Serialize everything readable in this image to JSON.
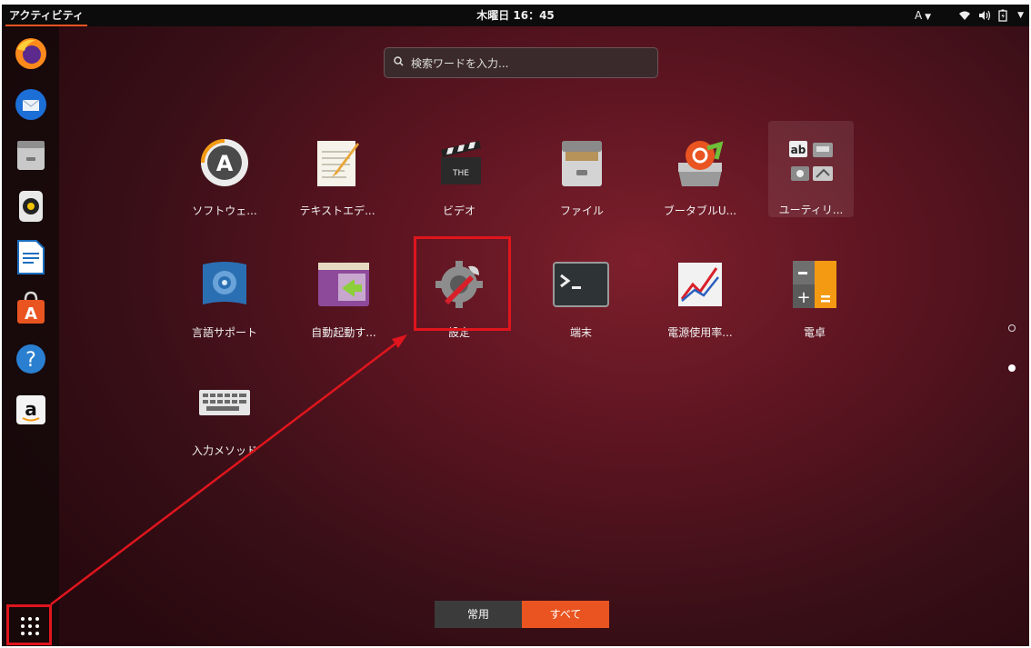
{
  "topbar": {
    "activities": "アクティビティ",
    "clock": "木曜日 16：45",
    "input_method": "A"
  },
  "search": {
    "placeholder": "検索ワードを入力..."
  },
  "apps": [
    {
      "label": "ソフトウェ...",
      "icon": "software-icon"
    },
    {
      "label": "テキストエデ...",
      "icon": "text-editor-icon"
    },
    {
      "label": "ビデオ",
      "icon": "video-icon"
    },
    {
      "label": "ファイル",
      "icon": "files-icon"
    },
    {
      "label": "ブータブルU...",
      "icon": "usb-creator-icon"
    },
    {
      "label": "ユーティリ...",
      "icon": "utilities-folder-icon"
    },
    {
      "label": "言語サポート",
      "icon": "language-support-icon"
    },
    {
      "label": "自動起動す...",
      "icon": "startup-apps-icon"
    },
    {
      "label": "設定",
      "icon": "settings-icon"
    },
    {
      "label": "端末",
      "icon": "terminal-icon"
    },
    {
      "label": "電源使用率...",
      "icon": "power-stats-icon"
    },
    {
      "label": "電卓",
      "icon": "calculator-icon"
    },
    {
      "label": "入力メソッド",
      "icon": "input-method-icon"
    }
  ],
  "view_tabs": {
    "frequent": "常用",
    "all": "すべて"
  },
  "colors": {
    "accent": "#e95420",
    "highlight": "#e0151d"
  },
  "pages": {
    "total": 2,
    "current": 2
  }
}
